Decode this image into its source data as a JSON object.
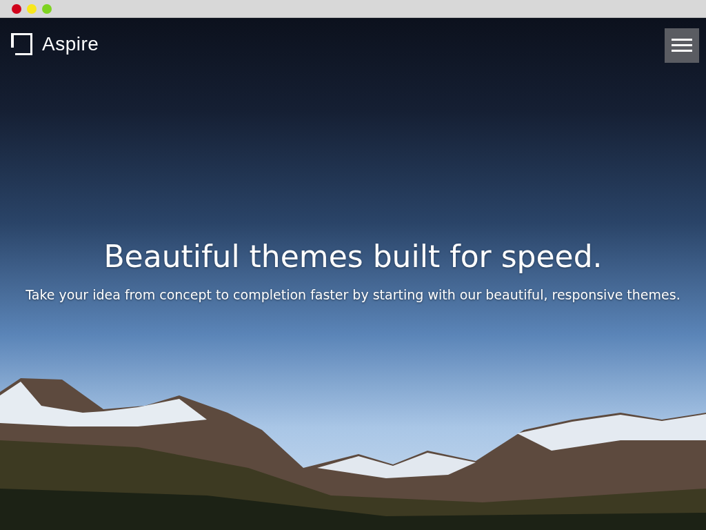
{
  "window": {
    "controls": [
      {
        "color": "#d0021b"
      },
      {
        "color": "#f8e71c"
      },
      {
        "color": "#7ed321"
      }
    ]
  },
  "nav": {
    "brand": "Aspire"
  },
  "hero": {
    "heading": "Beautiful themes built for speed.",
    "subheading": "Take your idea from concept to completion faster by starting with our beautiful, responsive themes."
  }
}
